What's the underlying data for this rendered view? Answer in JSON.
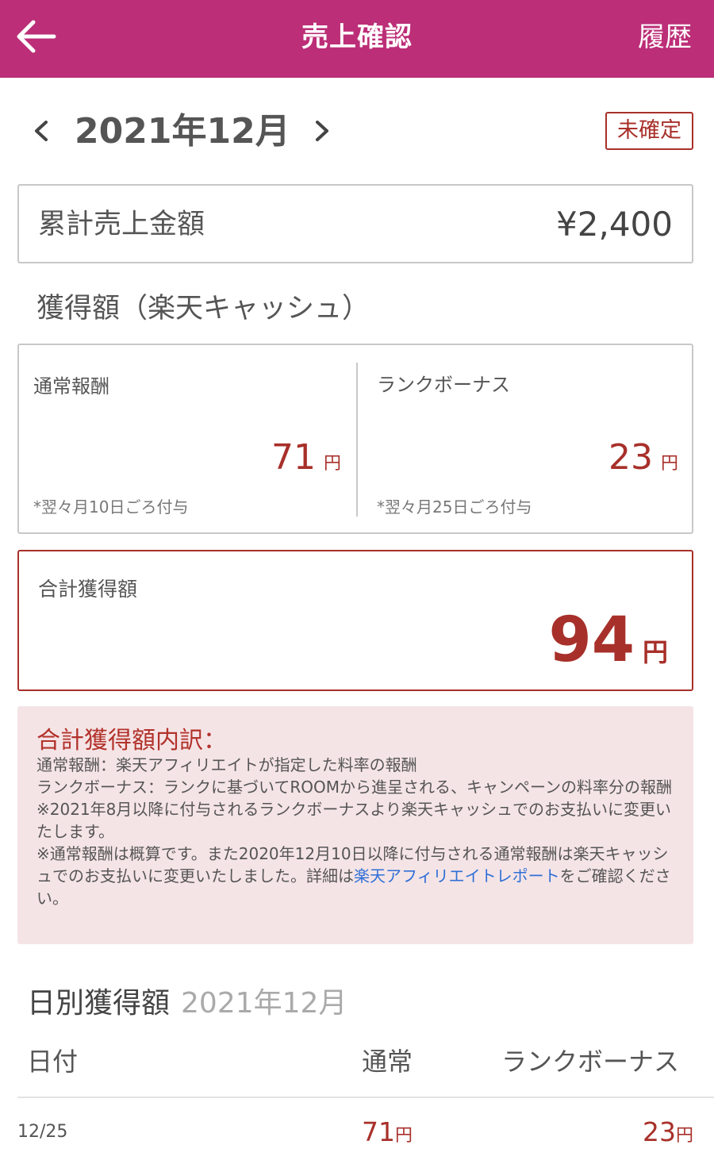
{
  "header": {
    "title": "売上確認",
    "history": "履歴"
  },
  "month_nav": {
    "month": "2021年12月",
    "status_badge": "未確定"
  },
  "total_sales": {
    "label": "累計売上金額",
    "value": "¥2,400"
  },
  "earned_section": {
    "title": "獲得額（楽天キャッシュ）",
    "normal": {
      "label": "通常報酬",
      "amount": "71",
      "unit": "円",
      "note": "*翌々月10日ごろ付与"
    },
    "rank_bonus": {
      "label": "ランクボーナス",
      "amount": "23",
      "unit": "円",
      "note": "*翌々月25日ごろ付与"
    }
  },
  "total_earned": {
    "label": "合計獲得額",
    "amount": "94",
    "unit": "円"
  },
  "breakdown": {
    "title": "合計獲得額内訳：",
    "line1": "通常報酬：楽天アフィリエイトが指定した料率の報酬",
    "line2": "ランクボーナス：ランクに基づいてROOMから進呈される、キャンペーンの料率分の報酬",
    "line3": "※2021年8月以降に付与されるランクボーナスより楽天キャッシュでのお支払いに変更いたします。",
    "line4_pre": "※通常報酬は概算です。また2020年12月10日以降に付与される通常報酬は楽天キャッシュでのお支払いに変更いたしました。詳細は",
    "link": "楽天アフィリエイトレポート",
    "line4_post": "をご確認ください。"
  },
  "daily": {
    "title": "日別獲得額",
    "month": "2021年12月",
    "headers": {
      "date": "日付",
      "normal": "通常",
      "rank": "ランクボーナス"
    },
    "rows": [
      {
        "date": "12/25",
        "normal": "71",
        "rank": "23",
        "unit": "円"
      }
    ]
  },
  "colors": {
    "header_bg": "#bc2e77",
    "accent_red": "#a8302a",
    "breakdown_bg": "#f5e4e6",
    "link": "#2f6fd6"
  }
}
